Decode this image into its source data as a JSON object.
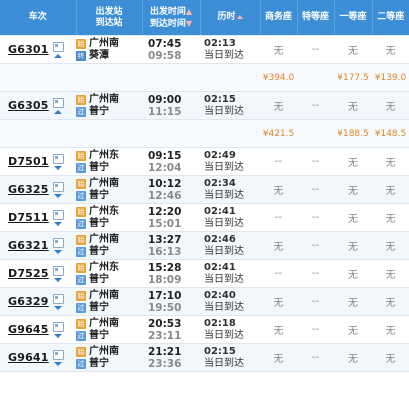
{
  "header": {
    "train": "车次",
    "station_from": "出发站",
    "station_to": "到达站",
    "time_depart": "出发时间",
    "time_arrive": "到达时间",
    "duration": "历时",
    "business": "商务座",
    "special": "特等座",
    "first": "一等座",
    "second": "二等座"
  },
  "colors": {
    "header_bg": "#3c8fd6",
    "price": "#e0862a",
    "sort_arrow": "#ffb3b3"
  },
  "rows": [
    {
      "train": "G6301",
      "chev": "up",
      "from": "广州南",
      "from_badge": "始",
      "to": "葵潭",
      "to_badge": "终",
      "depart": "07:45",
      "arrive": "09:58",
      "duration": "02:13",
      "arrive_day": "当日到达",
      "business": "无",
      "special": "--",
      "first": "无",
      "second": "无",
      "prices": {
        "business": "¥394.0",
        "special": "",
        "first": "¥177.5",
        "second": "¥139.0"
      }
    },
    {
      "train": "G6305",
      "chev": "up",
      "from": "广州南",
      "from_badge": "始",
      "to": "普宁",
      "to_badge": "过",
      "depart": "09:00",
      "arrive": "11:15",
      "duration": "02:15",
      "arrive_day": "当日到达",
      "business": "无",
      "special": "--",
      "first": "无",
      "second": "无",
      "prices": {
        "business": "¥421.5",
        "special": "",
        "first": "¥188.5",
        "second": "¥148.5"
      }
    },
    {
      "train": "D7501",
      "chev": "down",
      "from": "广州东",
      "from_badge": "始",
      "to": "普宁",
      "to_badge": "过",
      "depart": "09:15",
      "arrive": "12:04",
      "duration": "02:49",
      "arrive_day": "当日到达",
      "business": "--",
      "special": "--",
      "first": "无",
      "second": "无"
    },
    {
      "train": "G6325",
      "chev": "down",
      "from": "广州南",
      "from_badge": "始",
      "to": "普宁",
      "to_badge": "过",
      "depart": "10:12",
      "arrive": "12:46",
      "duration": "02:34",
      "arrive_day": "当日到达",
      "business": "无",
      "special": "--",
      "first": "无",
      "second": "无"
    },
    {
      "train": "D7511",
      "chev": "down",
      "from": "广州东",
      "from_badge": "始",
      "to": "普宁",
      "to_badge": "过",
      "depart": "12:20",
      "arrive": "15:01",
      "duration": "02:41",
      "arrive_day": "当日到达",
      "business": "--",
      "special": "--",
      "first": "无",
      "second": "无"
    },
    {
      "train": "G6321",
      "chev": "down",
      "from": "广州南",
      "from_badge": "始",
      "to": "普宁",
      "to_badge": "过",
      "depart": "13:27",
      "arrive": "16:13",
      "duration": "02:46",
      "arrive_day": "当日到达",
      "business": "无",
      "special": "--",
      "first": "无",
      "second": "无"
    },
    {
      "train": "D7525",
      "chev": "down",
      "from": "广州东",
      "from_badge": "始",
      "to": "普宁",
      "to_badge": "过",
      "depart": "15:28",
      "arrive": "18:09",
      "duration": "02:41",
      "arrive_day": "当日到达",
      "business": "--",
      "special": "--",
      "first": "无",
      "second": "无"
    },
    {
      "train": "G6329",
      "chev": "down",
      "from": "广州南",
      "from_badge": "始",
      "to": "普宁",
      "to_badge": "过",
      "depart": "17:10",
      "arrive": "19:50",
      "duration": "02:40",
      "arrive_day": "当日到达",
      "business": "无",
      "special": "--",
      "first": "无",
      "second": "无"
    },
    {
      "train": "G9645",
      "chev": "down",
      "from": "广州南",
      "from_badge": "始",
      "to": "普宁",
      "to_badge": "过",
      "depart": "20:53",
      "arrive": "23:11",
      "duration": "02:18",
      "arrive_day": "当日到达",
      "business": "无",
      "special": "--",
      "first": "无",
      "second": "无"
    },
    {
      "train": "G9641",
      "chev": "down",
      "from": "广州南",
      "from_badge": "始",
      "to": "普宁",
      "to_badge": "过",
      "depart": "21:21",
      "arrive": "23:36",
      "duration": "02:15",
      "arrive_day": "当日到达",
      "business": "无",
      "special": "--",
      "first": "无",
      "second": "无"
    }
  ]
}
